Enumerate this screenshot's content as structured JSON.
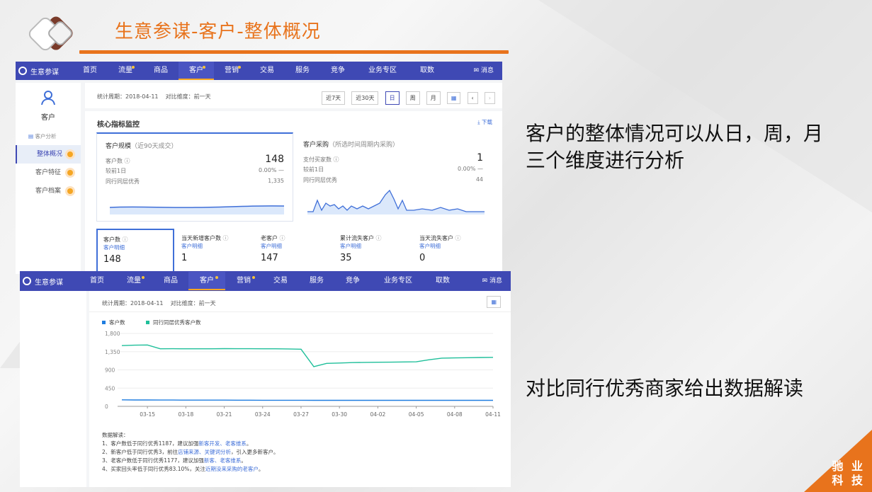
{
  "slide": {
    "title": "生意参谋-客户-整体概况",
    "desc1_line1": "客户的整体情况可以从日，周，月",
    "desc1_line2": "三个维度进行分析",
    "desc2": "对比同行优秀商家给出数据解读",
    "brand_line1": "驰 业",
    "brand_line2": "科 技",
    "accent": "#e8731c"
  },
  "nav": {
    "logo": "生意参谋",
    "items": [
      "首页",
      "流量",
      "商品",
      "客户",
      "营销",
      "交易",
      "服务",
      "竞争",
      "业务专区",
      "取数"
    ],
    "active": "客户",
    "message": "消息",
    "color": "#3f49b4"
  },
  "top": {
    "sidebar_title": "客户",
    "sidebar_section": "客户分析",
    "sidebar_items": [
      "整体概况",
      "客户特征",
      "客户档案"
    ],
    "stat_period_label": "统计周期：",
    "stat_period_value": "2018-04-11",
    "compare_label": "对比维度：",
    "compare_value": "前一天",
    "range_buttons": [
      "近7天",
      "近30天",
      "日",
      "周",
      "月"
    ],
    "section_title": "核心指标监控",
    "download": "下载",
    "scale_card": {
      "title": "客户规模",
      "title_note": "（近90天成交）",
      "metric_label": "客户数",
      "metric_value": "148",
      "compare_label": "较前1日",
      "compare_value": "0.00%",
      "compare_trend": "—",
      "peer_label": "同行同层优秀",
      "peer_value": "1,335"
    },
    "purchase_card": {
      "title": "客户采购",
      "title_note": "（所选时间周期内采购）",
      "metric_label": "支付买家数",
      "metric_value": "1",
      "compare_label": "较前1日",
      "compare_value": "0.00%",
      "compare_trend": "—",
      "peer_label": "同行同层优秀",
      "peer_value": "44"
    },
    "metrics": [
      {
        "label": "客户数",
        "sub": "客户明细",
        "value": "148"
      },
      {
        "label": "当天新增客户数",
        "sub": "客户明细",
        "value": "1"
      },
      {
        "label": "老客户",
        "sub": "客户明细",
        "value": "147"
      },
      {
        "label": "累计流失客户",
        "sub": "客户明细",
        "value": "35"
      },
      {
        "label": "当天流失客户",
        "sub": "客户明细",
        "value": "0"
      }
    ]
  },
  "bottom": {
    "stat_period_label": "统计周期：",
    "stat_period_value": "2018-04-11",
    "compare_label": "对比维度：",
    "compare_value": "前一天",
    "interpret_title": "数据解读：",
    "interpret": [
      {
        "prefix": "1、客户数低于同行优秀1187，建议加强",
        "links": "新客开发、老客维系",
        "suffix": "。"
      },
      {
        "prefix": "2、新客户低于同行优秀3，前往",
        "links": "店铺来源、关键词分析",
        "suffix": "，引入更多新客户。"
      },
      {
        "prefix": "3、老客户数低于同行优秀1177，建议加强",
        "links": "新客、老客维系",
        "suffix": "。"
      },
      {
        "prefix": "4、买家回头率低于同行优秀83.10%，关注",
        "links": "近期没来采购的老客户",
        "suffix": "。"
      }
    ]
  },
  "chart_data": {
    "type": "line",
    "title": "",
    "xlabel": "",
    "ylabel": "",
    "x": [
      "03-13",
      "03-14",
      "03-15",
      "03-16",
      "03-17",
      "03-18",
      "03-19",
      "03-20",
      "03-21",
      "03-22",
      "03-23",
      "03-24",
      "03-25",
      "03-26",
      "03-27",
      "03-28",
      "03-29",
      "03-30",
      "03-31",
      "04-01",
      "04-02",
      "04-03",
      "04-04",
      "04-05",
      "04-06",
      "04-07",
      "04-08",
      "04-09",
      "04-10",
      "04-11"
    ],
    "x_ticks": [
      "03-15",
      "03-18",
      "03-21",
      "03-24",
      "03-27",
      "03-30",
      "04-02",
      "04-05",
      "04-08",
      "04-11"
    ],
    "y_ticks": [
      "1,800",
      "1,350",
      "900",
      "450",
      "0"
    ],
    "ylim": [
      0,
      1800
    ],
    "series": [
      {
        "name": "客户数",
        "color": "#1f7de0",
        "values": [
          160,
          158,
          157,
          156,
          155,
          154,
          154,
          153,
          153,
          152,
          152,
          151,
          151,
          150,
          150,
          149,
          149,
          149,
          149,
          149,
          149,
          148,
          148,
          148,
          148,
          148,
          148,
          148,
          148,
          148
        ]
      },
      {
        "name": "同行同层优秀客户数",
        "color": "#1fbf9a",
        "values": [
          1500,
          1510,
          1515,
          1420,
          1422,
          1420,
          1421,
          1420,
          1425,
          1423,
          1422,
          1420,
          1420,
          1418,
          1410,
          980,
          1060,
          1070,
          1080,
          1085,
          1088,
          1090,
          1095,
          1100,
          1150,
          1190,
          1195,
          1200,
          1205,
          1210
        ]
      }
    ],
    "legend": "top-left"
  }
}
